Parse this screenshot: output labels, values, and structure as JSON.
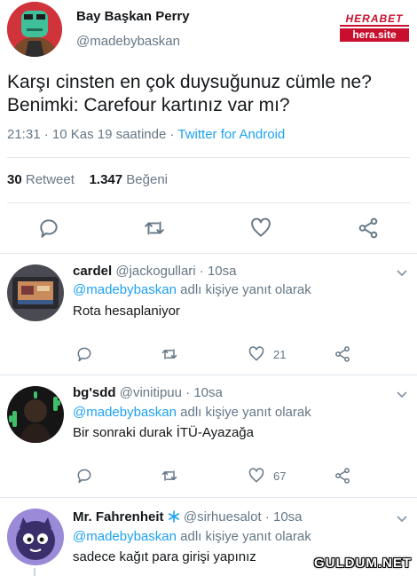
{
  "main_tweet": {
    "author_name": "Bay Başkan Perry",
    "author_handle": "@madebybaskan",
    "text": "Karşı cinsten en çok duysuğunuz cümle ne?\nBenimki: Carefour kartınız var mı?",
    "time": "21:31 · 10 Kas 19 saatinde · ",
    "source": "Twitter for Android",
    "retweet_count": "30",
    "retweet_label": "Retweet",
    "like_count": "1.347",
    "like_label": "Beğeni",
    "avatar_icon": "frog-avatar-icon"
  },
  "watermark": {
    "top": "HERABET",
    "bottom": "hera.site"
  },
  "actions": {
    "icons": [
      "reply-icon",
      "retweet-icon",
      "like-icon",
      "share-icon"
    ]
  },
  "replies": [
    {
      "name": "cardel",
      "handle": "@jackogullari · 10sa",
      "mention": "@madebybaskan",
      "reply_suffix": " adlı kişiye yanıt olarak",
      "text": "Rota hesaplaniyor",
      "like_count": "21"
    },
    {
      "name": "bg'sdd",
      "handle": "@vinitipuu · 10sa",
      "mention": "@madebybaskan",
      "reply_suffix": " adlı kişiye yanıt olarak",
      "text": "Bir sonraki durak İTÜ-Ayazağa",
      "like_count": "67"
    },
    {
      "name": "Mr. Fahrenheit",
      "handle": "@sirhuesalot · 10sa",
      "mention": "@madebybaskan",
      "reply_suffix": " adlı kişiye yanıt olarak",
      "text": "sadece kağıt para girişi yapınız",
      "like_count": ""
    }
  ],
  "site_watermark": "GULDUM.NET",
  "colors": {
    "link": "#1da1f2",
    "secondary_text": "#657786",
    "divider": "#e1e8ed",
    "watermark_red": "#c8102e"
  }
}
